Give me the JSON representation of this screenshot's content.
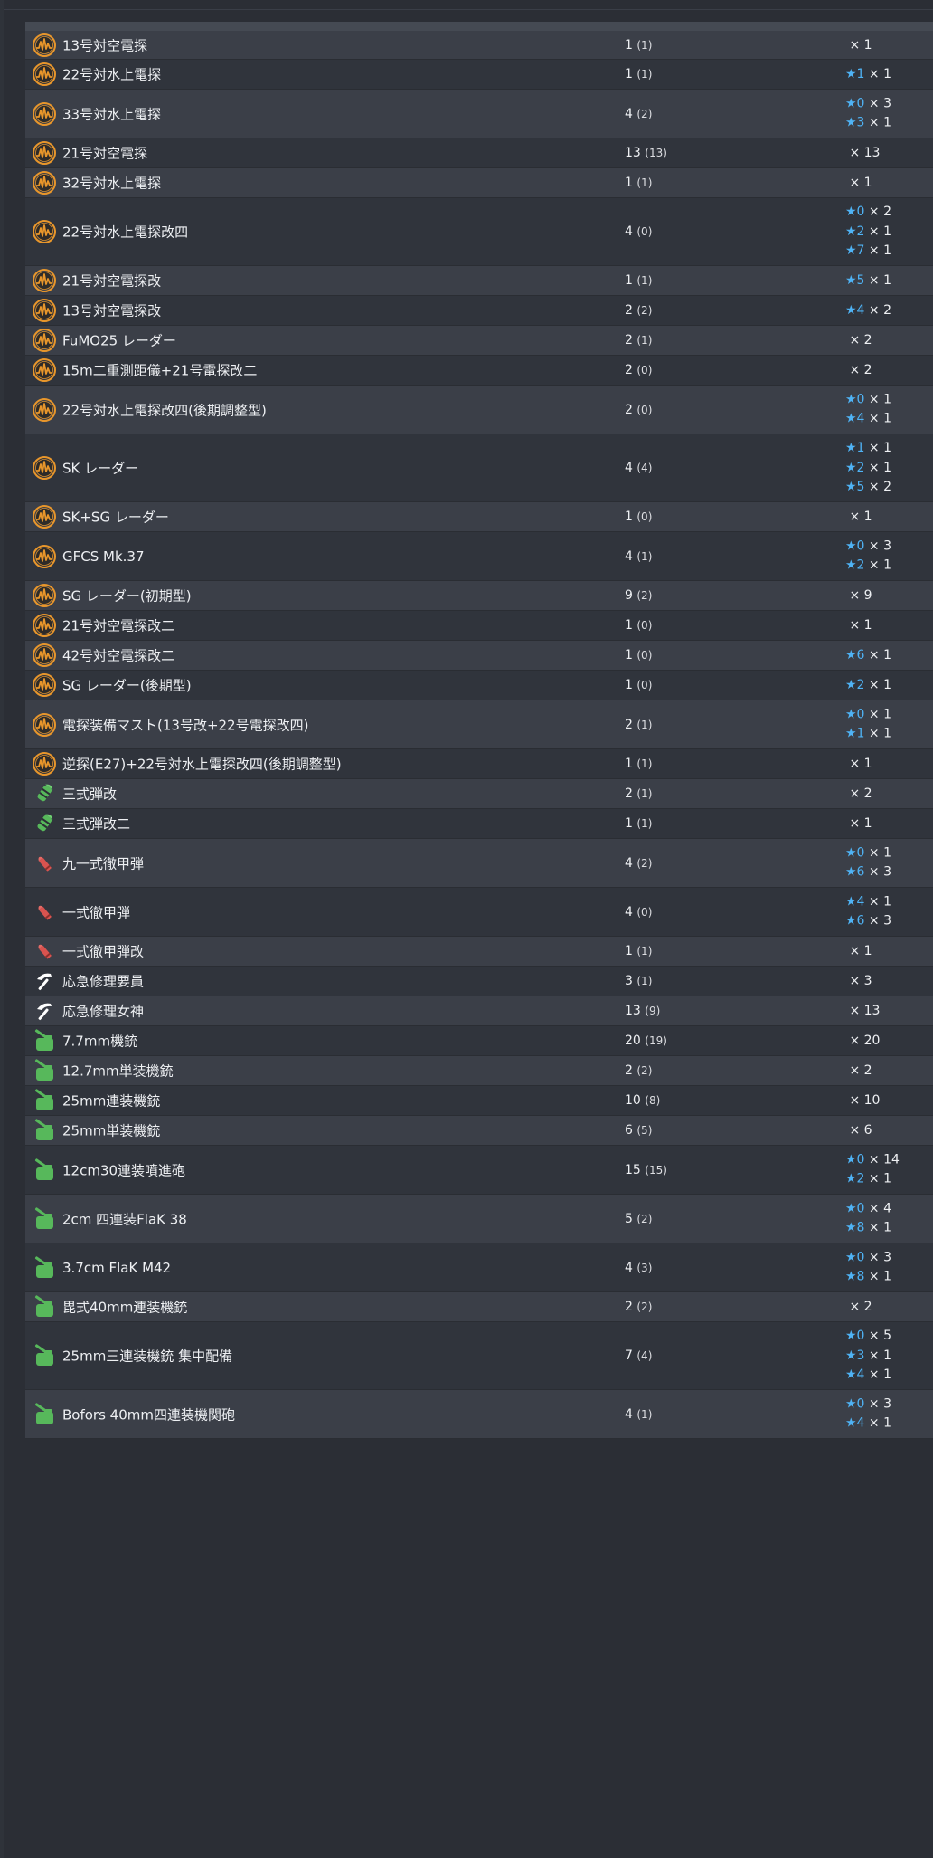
{
  "colors": {
    "background": "#2b2e35",
    "row_odd": "#3b3f48",
    "row_even": "#30343c",
    "radar_icon": "#e8962b",
    "ammo_green_icon": "#57b85b",
    "ap_shell_icon": "#d9534f",
    "repair_icon": "#ffffff",
    "aa_gun_icon": "#57b85b",
    "star": "#4fb3f5"
  },
  "rows": [
    {
      "icon": "radar-icon",
      "name": "13号対空電探",
      "count": "1",
      "sub": "(1)",
      "details": [
        {
          "star": "",
          "mult": "× 1"
        }
      ]
    },
    {
      "icon": "radar-icon",
      "name": "22号対水上電探",
      "count": "1",
      "sub": "(1)",
      "details": [
        {
          "star": "★1",
          "mult": "× 1"
        }
      ]
    },
    {
      "icon": "radar-icon",
      "name": "33号対水上電探",
      "count": "4",
      "sub": "(2)",
      "details": [
        {
          "star": "★0",
          "mult": "× 3"
        },
        {
          "star": "★3",
          "mult": "× 1"
        }
      ]
    },
    {
      "icon": "radar-icon",
      "name": "21号対空電探",
      "count": "13",
      "sub": "(13)",
      "details": [
        {
          "star": "",
          "mult": "× 13"
        }
      ]
    },
    {
      "icon": "radar-icon",
      "name": "32号対水上電探",
      "count": "1",
      "sub": "(1)",
      "details": [
        {
          "star": "",
          "mult": "× 1"
        }
      ]
    },
    {
      "icon": "radar-icon",
      "name": "22号対水上電探改四",
      "count": "4",
      "sub": "(0)",
      "details": [
        {
          "star": "★0",
          "mult": "× 2"
        },
        {
          "star": "★2",
          "mult": "× 1"
        },
        {
          "star": "★7",
          "mult": "× 1"
        }
      ]
    },
    {
      "icon": "radar-icon",
      "name": "21号対空電探改",
      "count": "1",
      "sub": "(1)",
      "details": [
        {
          "star": "★5",
          "mult": "× 1"
        }
      ]
    },
    {
      "icon": "radar-icon",
      "name": "13号対空電探改",
      "count": "2",
      "sub": "(2)",
      "details": [
        {
          "star": "★4",
          "mult": "× 2"
        }
      ]
    },
    {
      "icon": "radar-icon",
      "name": "FuMO25 レーダー",
      "count": "2",
      "sub": "(1)",
      "details": [
        {
          "star": "",
          "mult": "× 2"
        }
      ]
    },
    {
      "icon": "radar-icon",
      "name": "15m二重測距儀+21号電探改二",
      "count": "2",
      "sub": "(0)",
      "details": [
        {
          "star": "",
          "mult": "× 2"
        }
      ]
    },
    {
      "icon": "radar-icon",
      "name": "22号対水上電探改四(後期調整型)",
      "count": "2",
      "sub": "(0)",
      "details": [
        {
          "star": "★0",
          "mult": "× 1"
        },
        {
          "star": "★4",
          "mult": "× 1"
        }
      ]
    },
    {
      "icon": "radar-icon",
      "name": "SK レーダー",
      "count": "4",
      "sub": "(4)",
      "details": [
        {
          "star": "★1",
          "mult": "× 1"
        },
        {
          "star": "★2",
          "mult": "× 1"
        },
        {
          "star": "★5",
          "mult": "× 2"
        }
      ]
    },
    {
      "icon": "radar-icon",
      "name": "SK+SG レーダー",
      "count": "1",
      "sub": "(0)",
      "details": [
        {
          "star": "",
          "mult": "× 1"
        }
      ]
    },
    {
      "icon": "radar-icon",
      "name": "GFCS Mk.37",
      "count": "4",
      "sub": "(1)",
      "details": [
        {
          "star": "★0",
          "mult": "× 3"
        },
        {
          "star": "★2",
          "mult": "× 1"
        }
      ]
    },
    {
      "icon": "radar-icon",
      "name": "SG レーダー(初期型)",
      "count": "9",
      "sub": "(2)",
      "details": [
        {
          "star": "",
          "mult": "× 9"
        }
      ]
    },
    {
      "icon": "radar-icon",
      "name": "21号対空電探改二",
      "count": "1",
      "sub": "(0)",
      "details": [
        {
          "star": "",
          "mult": "× 1"
        }
      ]
    },
    {
      "icon": "radar-icon",
      "name": "42号対空電探改二",
      "count": "1",
      "sub": "(0)",
      "details": [
        {
          "star": "★6",
          "mult": "× 1"
        }
      ]
    },
    {
      "icon": "radar-icon",
      "name": "SG レーダー(後期型)",
      "count": "1",
      "sub": "(0)",
      "details": [
        {
          "star": "★2",
          "mult": "× 1"
        }
      ]
    },
    {
      "icon": "radar-icon",
      "name": "電探装備マスト(13号改+22号電探改四)",
      "count": "2",
      "sub": "(1)",
      "details": [
        {
          "star": "★0",
          "mult": "× 1"
        },
        {
          "star": "★1",
          "mult": "× 1"
        }
      ]
    },
    {
      "icon": "radar-icon",
      "name": "逆探(E27)+22号対水上電探改四(後期調整型)",
      "count": "1",
      "sub": "(1)",
      "details": [
        {
          "star": "",
          "mult": "× 1"
        }
      ]
    },
    {
      "icon": "type3-shell-icon",
      "name": "三式弾改",
      "count": "2",
      "sub": "(1)",
      "details": [
        {
          "star": "",
          "mult": "× 2"
        }
      ]
    },
    {
      "icon": "type3-shell-icon",
      "name": "三式弾改二",
      "count": "1",
      "sub": "(1)",
      "details": [
        {
          "star": "",
          "mult": "× 1"
        }
      ]
    },
    {
      "icon": "ap-shell-icon",
      "name": "九一式徹甲弾",
      "count": "4",
      "sub": "(2)",
      "details": [
        {
          "star": "★0",
          "mult": "× 1"
        },
        {
          "star": "★6",
          "mult": "× 3"
        }
      ]
    },
    {
      "icon": "ap-shell-icon",
      "name": "一式徹甲弾",
      "count": "4",
      "sub": "(0)",
      "details": [
        {
          "star": "★4",
          "mult": "× 1"
        },
        {
          "star": "★6",
          "mult": "× 3"
        }
      ]
    },
    {
      "icon": "ap-shell-icon",
      "name": "一式徹甲弾改",
      "count": "1",
      "sub": "(1)",
      "details": [
        {
          "star": "",
          "mult": "× 1"
        }
      ]
    },
    {
      "icon": "repair-icon",
      "name": "応急修理要員",
      "count": "3",
      "sub": "(1)",
      "details": [
        {
          "star": "",
          "mult": "× 3"
        }
      ]
    },
    {
      "icon": "repair-icon",
      "name": "応急修理女神",
      "count": "13",
      "sub": "(9)",
      "details": [
        {
          "star": "",
          "mult": "× 13"
        }
      ]
    },
    {
      "icon": "aa-gun-icon",
      "name": "7.7mm機銃",
      "count": "20",
      "sub": "(19)",
      "details": [
        {
          "star": "",
          "mult": "× 20"
        }
      ]
    },
    {
      "icon": "aa-gun-icon",
      "name": "12.7mm単装機銃",
      "count": "2",
      "sub": "(2)",
      "details": [
        {
          "star": "",
          "mult": "× 2"
        }
      ]
    },
    {
      "icon": "aa-gun-icon",
      "name": "25mm連装機銃",
      "count": "10",
      "sub": "(8)",
      "details": [
        {
          "star": "",
          "mult": "× 10"
        }
      ]
    },
    {
      "icon": "aa-gun-icon",
      "name": "25mm単装機銃",
      "count": "6",
      "sub": "(5)",
      "details": [
        {
          "star": "",
          "mult": "× 6"
        }
      ]
    },
    {
      "icon": "aa-gun-icon",
      "name": "12cm30連装噴進砲",
      "count": "15",
      "sub": "(15)",
      "details": [
        {
          "star": "★0",
          "mult": "× 14"
        },
        {
          "star": "★2",
          "mult": "× 1"
        }
      ]
    },
    {
      "icon": "aa-gun-icon",
      "name": "2cm 四連装FlaK 38",
      "count": "5",
      "sub": "(2)",
      "details": [
        {
          "star": "★0",
          "mult": "× 4"
        },
        {
          "star": "★8",
          "mult": "× 1"
        }
      ]
    },
    {
      "icon": "aa-gun-icon",
      "name": "3.7cm FlaK M42",
      "count": "4",
      "sub": "(3)",
      "details": [
        {
          "star": "★0",
          "mult": "× 3"
        },
        {
          "star": "★8",
          "mult": "× 1"
        }
      ]
    },
    {
      "icon": "aa-gun-icon",
      "name": "毘式40mm連装機銃",
      "count": "2",
      "sub": "(2)",
      "details": [
        {
          "star": "",
          "mult": "× 2"
        }
      ]
    },
    {
      "icon": "aa-gun-icon",
      "name": "25mm三連装機銃 集中配備",
      "count": "7",
      "sub": "(4)",
      "details": [
        {
          "star": "★0",
          "mult": "× 5"
        },
        {
          "star": "★3",
          "mult": "× 1"
        },
        {
          "star": "★4",
          "mult": "× 1"
        }
      ]
    },
    {
      "icon": "aa-gun-icon",
      "name": "Bofors 40mm四連装機関砲",
      "count": "4",
      "sub": "(1)",
      "details": [
        {
          "star": "★0",
          "mult": "× 3"
        },
        {
          "star": "★4",
          "mult": "× 1"
        }
      ]
    }
  ]
}
